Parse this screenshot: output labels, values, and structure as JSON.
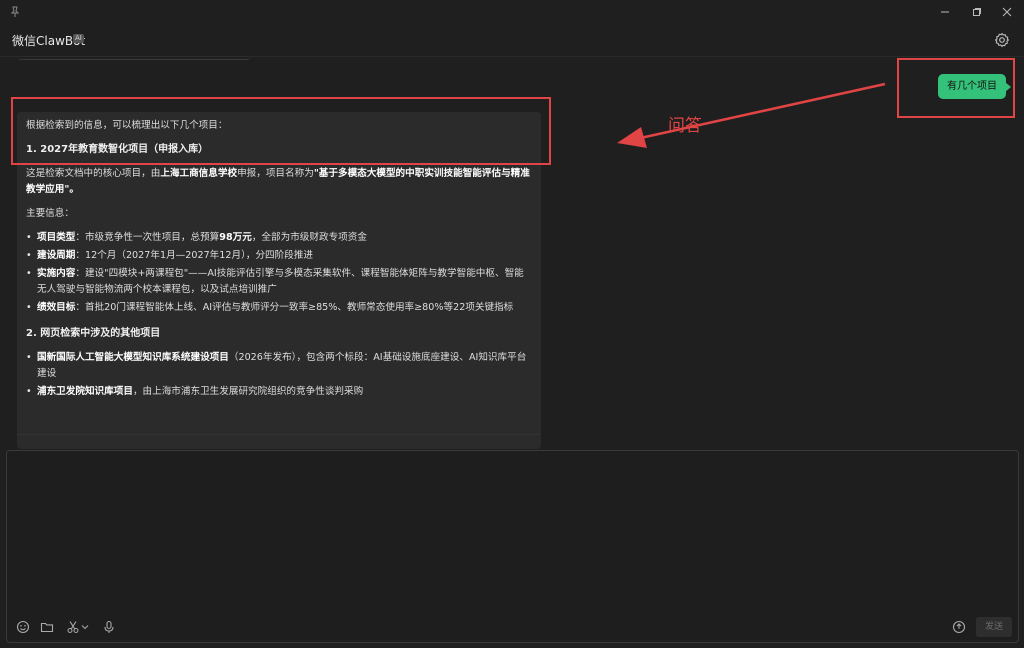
{
  "app": {
    "title": "微信ClawBot",
    "badge": "AI"
  },
  "chat": {
    "user_message": "有几个项目",
    "reply": {
      "intro": "根据检索到的信息，可以梳理出以下几个项目：",
      "section1_heading": "1. 2027年教育数智化项目（申报入库）",
      "section1_para_a": "这是检索文档中的核心项目，由",
      "section1_para_b": "上海工商信息学校",
      "section1_para_c": "申报，项目名称为",
      "section1_para_d": "\"基于多模态大模型的中职实训技能智能评估与精准教学应用\"。",
      "main_info_label": "主要信息：",
      "items1": [
        {
          "key": "项目类型",
          "text_a": "：市级竞争性一次性项目，总预算",
          "bold": "98万元",
          "text_b": "，全部为市级财政专项资金"
        },
        {
          "key": "建设周期",
          "text_a": "：12个月（2027年1月—2027年12月），分四阶段推进",
          "bold": "",
          "text_b": ""
        },
        {
          "key": "实施内容",
          "text_a": "：建设\"四模块+两课程包\"——AI技能评估引擎与多模态采集软件、课程智能体矩阵与教学智能中枢、智能无人驾驶与智能物流两个校本课程包，以及试点培训推广",
          "bold": "",
          "text_b": ""
        },
        {
          "key": "绩效目标",
          "text_a": "：首批20门课程智能体上线、AI评估与教师评分一致率≥85%、教师常态使用率≥80%等22项关键指标",
          "bold": "",
          "text_b": ""
        }
      ],
      "section2_heading": "2. 网页检索中涉及的其他项目",
      "items2": [
        {
          "key": "国新国际人工智能大模型知识库系统建设项目",
          "text_a": "（2026年发布），包含两个标段：AI基础设施底座建设、AI知识库平台建设"
        },
        {
          "key": "浦东卫发院知识库项目",
          "text_a": "，由上海市浦东卫生发展研究院组织的竞争性谈判采购"
        }
      ]
    }
  },
  "annotation": {
    "label": "问答",
    "color": "#e04444"
  },
  "input": {
    "send_label": "发送",
    "value": ""
  },
  "icons": [
    "pin-icon",
    "minimize-icon",
    "restore-icon",
    "close-icon",
    "gear-icon",
    "emoji-icon",
    "folder-icon",
    "scissors-icon",
    "chevron-down-icon",
    "mic-icon",
    "bot-icon"
  ]
}
